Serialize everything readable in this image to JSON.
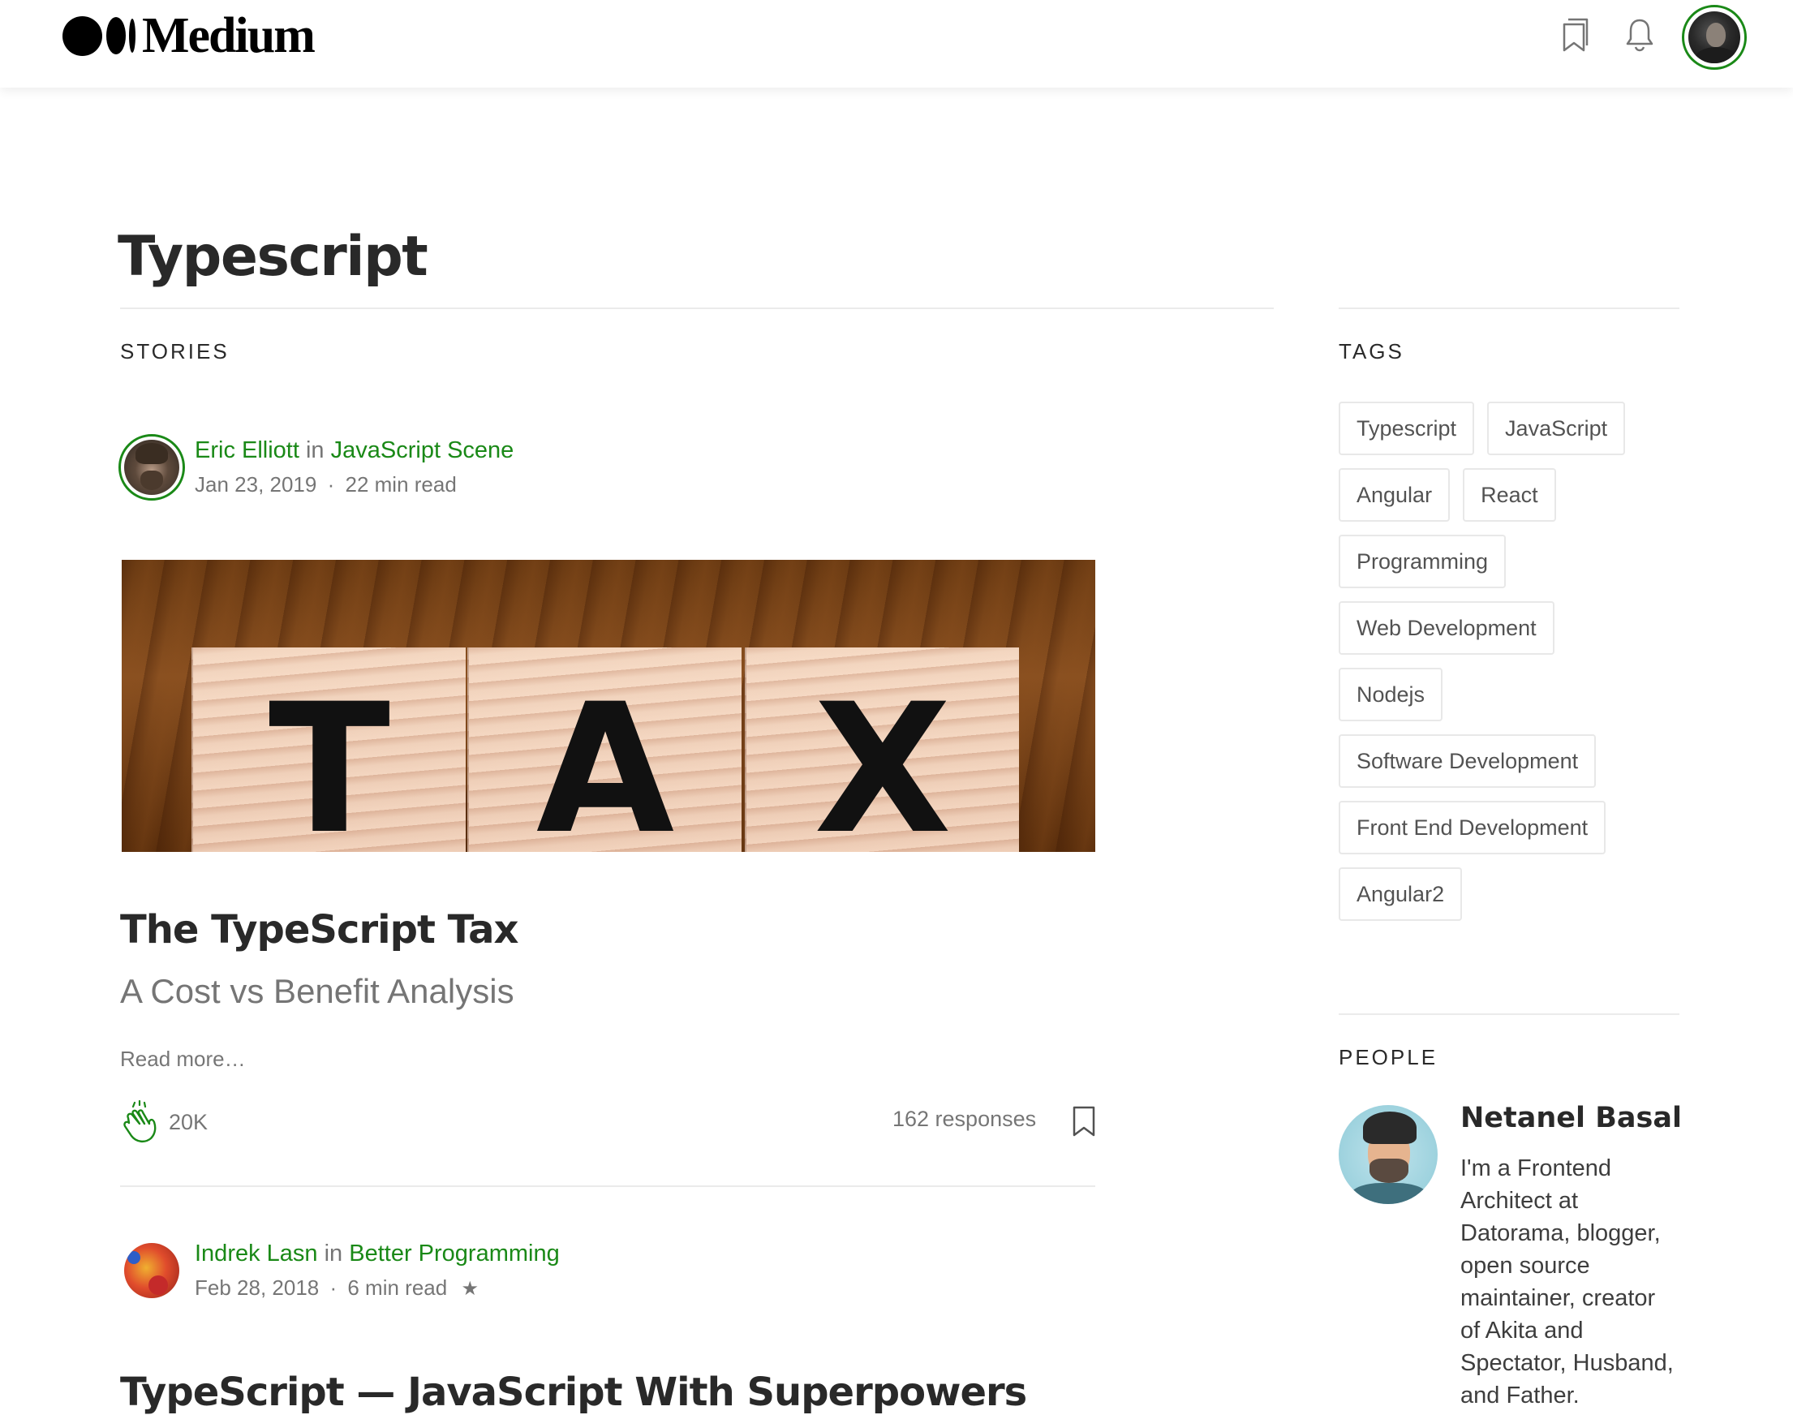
{
  "header": {
    "logo_text": "Medium",
    "icons": [
      "bookmarks-icon",
      "notifications-bell-icon",
      "user-avatar"
    ]
  },
  "page": {
    "title": "Typescript",
    "stories_label": "STORIES",
    "tags_label": "TAGS",
    "people_label": "PEOPLE"
  },
  "stories": [
    {
      "author": "Eric Elliott",
      "in": "in",
      "publication": "JavaScript Scene",
      "date": "Jan 23, 2019",
      "separator": "·",
      "read_time": "22 min read",
      "image_letters": [
        "T",
        "A",
        "X"
      ],
      "title": "The TypeScript Tax",
      "subtitle": "A Cost vs Benefit Analysis",
      "read_more": "Read more…",
      "claps": "20K",
      "responses": "162 responses"
    },
    {
      "author": "Indrek Lasn",
      "in": "in",
      "publication": "Better Programming",
      "date": "Feb 28, 2018",
      "separator": "·",
      "read_time": "6 min read",
      "member_star": "★",
      "title": "TypeScript — JavaScript With Superpowers"
    }
  ],
  "tags": [
    "Typescript",
    "JavaScript",
    "Angular",
    "React",
    "Programming",
    "Web Development",
    "Nodejs",
    "Software Development",
    "Front End Development",
    "Angular2"
  ],
  "people": [
    {
      "name": "Netanel Basal",
      "bio": "I'm a Frontend Architect at Datorama, blogger, open source maintainer, creator of Akita and Spectator, Husband, and Father."
    }
  ],
  "colors": {
    "accent_green": "#1a8917",
    "text_primary": "rgba(0,0,0,0.84)",
    "text_muted": "rgba(0,0,0,0.54)"
  }
}
